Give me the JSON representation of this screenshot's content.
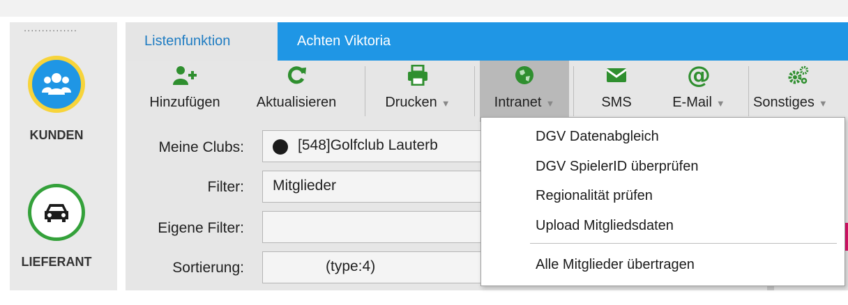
{
  "left_nav": {
    "dots": "...............",
    "items": [
      {
        "label": "KUNDEN",
        "icon": "users-icon"
      },
      {
        "label": "LIEFERANT",
        "icon": "car-icon"
      }
    ]
  },
  "ribbon": {
    "tabs": [
      {
        "label": "Listenfunktion",
        "active": true
      },
      {
        "label": "Achten Viktoria",
        "active": false
      }
    ],
    "buttons": {
      "add": "Hinzufügen",
      "refresh": "Aktualisieren",
      "print": "Drucken",
      "intranet": "Intranet",
      "sms": "SMS",
      "email": "E-Mail",
      "misc": "Sonstiges"
    }
  },
  "form": {
    "clubs_label": "Meine Clubs:",
    "clubs_value": "[548]Golfclub Lauterb",
    "filter_label": "Filter:",
    "filter_value": "Mitglieder",
    "own_filter_label": "Eigene Filter:",
    "own_filter_value": "",
    "sort_label": "Sortierung:",
    "sort_value": "(type:4)"
  },
  "intranet_menu": {
    "items": [
      "DGV Datenabgleich",
      "DGV SpielerID überprüfen",
      "Regionalität prüfen",
      "Upload Mitgliedsdaten",
      "Alle Mitglieder übertragen"
    ]
  },
  "colors": {
    "accent_blue": "#1f96e5",
    "green": "#34a13a",
    "yellow": "#f7d43b",
    "ribbon_bg": "#e6e6e6"
  }
}
